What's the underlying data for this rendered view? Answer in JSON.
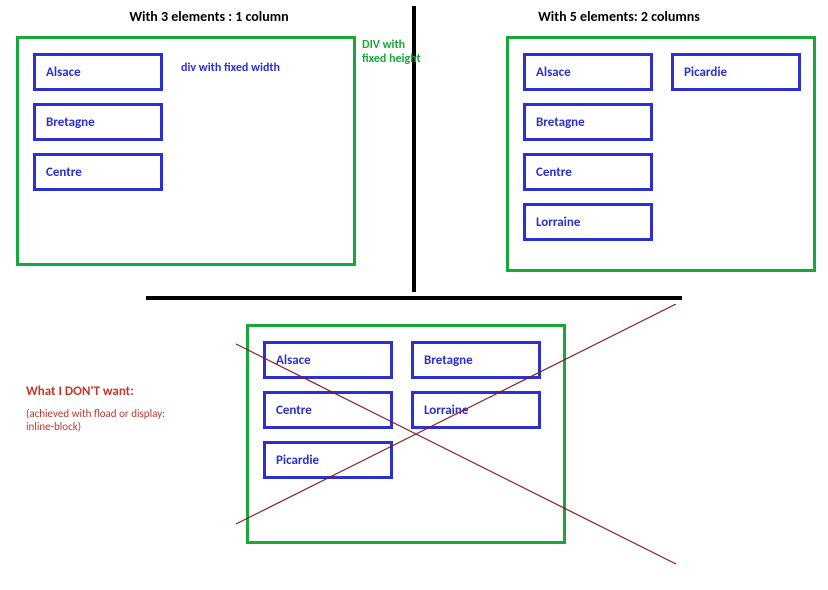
{
  "top_left": {
    "title": "With 3 elements : 1 column",
    "items": [
      "Alsace",
      "Bretagne",
      "Centre"
    ],
    "annot_inner": "div with fixed width",
    "annot_outer": "DIV with fixed height"
  },
  "top_right": {
    "title": "With 5 elements: 2 columns",
    "col1": [
      "Alsace",
      "Bretagne",
      "Centre",
      "Lorraine"
    ],
    "col2": [
      "Picardie"
    ]
  },
  "bottom": {
    "warn_title": "What I DON'T want:",
    "warn_sub": "(achieved with fload or display: inline-block)",
    "col1": [
      "Alsace",
      "Centre",
      "Picardie"
    ],
    "col2": [
      "Bretagne",
      "Lorraine"
    ]
  }
}
